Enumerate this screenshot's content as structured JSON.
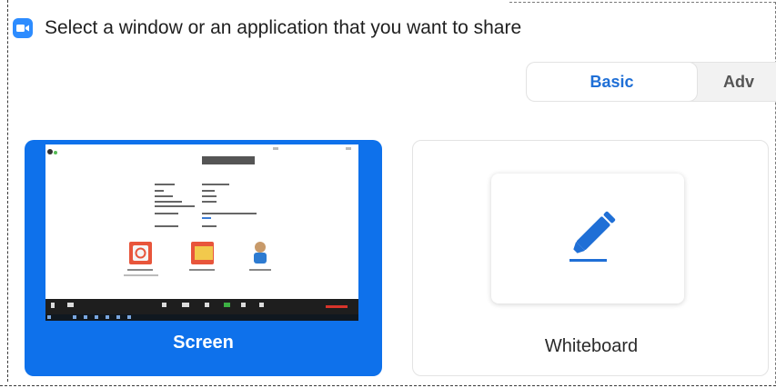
{
  "dialog": {
    "title": "Select a window or an application that you want to share"
  },
  "tabs": {
    "basic": "Basic",
    "advanced": "Adv"
  },
  "options": {
    "screen": {
      "label": "Screen",
      "selected": true
    },
    "whiteboard": {
      "label": "Whiteboard"
    }
  },
  "icons": {
    "app_logo": "zoom-camera-icon",
    "whiteboard": "pen-marker-icon"
  },
  "colors": {
    "accent": "#0e71eb",
    "tab_active_text": "#1f6fd6",
    "zoom_logo": "#2d8cff"
  }
}
